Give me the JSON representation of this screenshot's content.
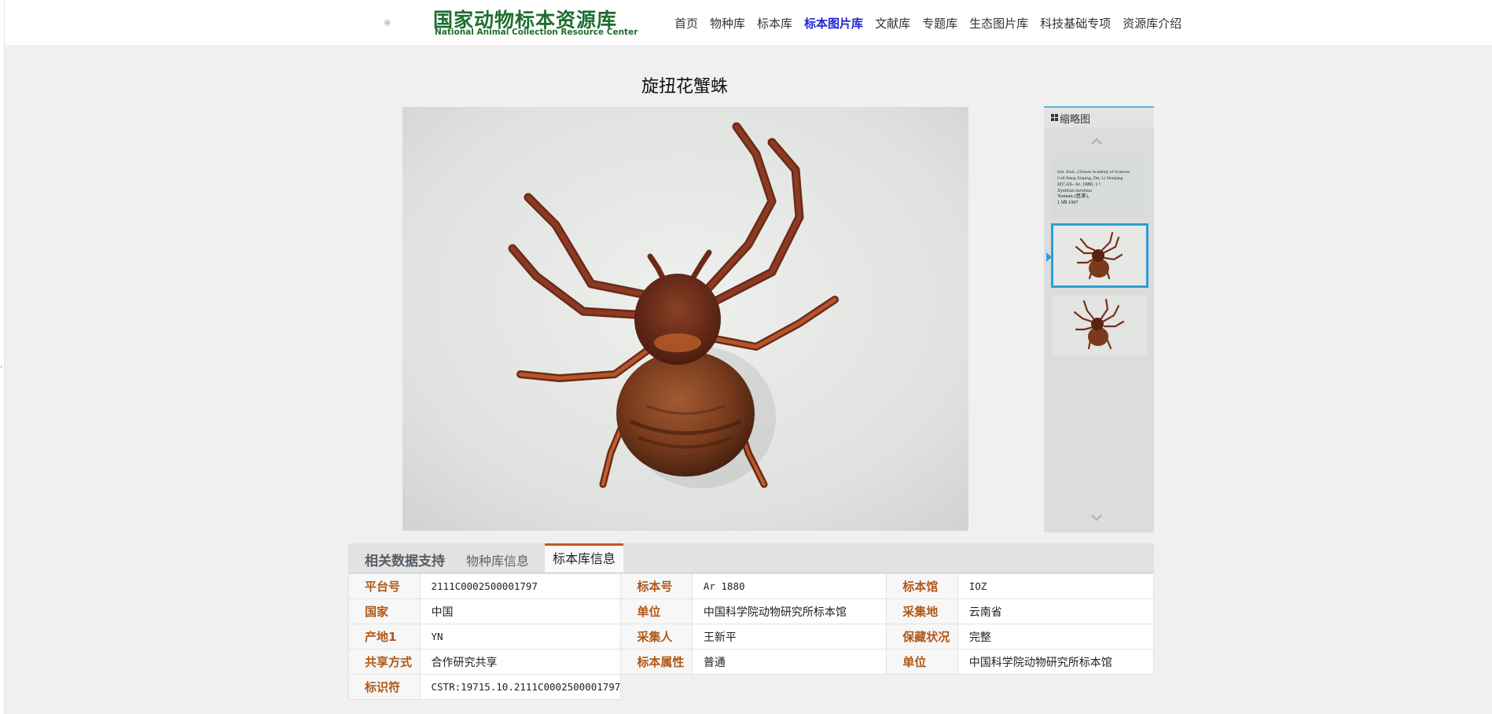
{
  "header": {
    "logo_title": "国家动物标本资源库",
    "logo_subtitle": "National Animal Collection Resource Center",
    "brand_color": "#1e6e30",
    "nav": [
      {
        "label": "首页",
        "active": false
      },
      {
        "label": "物种库",
        "active": false
      },
      {
        "label": "标本库",
        "active": false
      },
      {
        "label": "标本图片库",
        "active": true
      },
      {
        "label": "文献库",
        "active": false
      },
      {
        "label": "专题库",
        "active": false
      },
      {
        "label": "生态图片库",
        "active": false
      },
      {
        "label": "科技基础专项",
        "active": false
      },
      {
        "label": "资源库介绍",
        "active": false
      }
    ]
  },
  "page_title": "旋扭花蟹蛛",
  "thumbnails": {
    "heading": "缩略图",
    "icon": "grid-icon",
    "accent_color": "#2a9fd6",
    "label_card_lines": [
      "Inst. Zool., Chinese Academy of Sciences",
      "Coll.Wang Xinping, Det. Li Shuqiang",
      "IZCAS- Ar. 1880, 1♀",
      "Xysticus torsivus",
      "Yunnan (思茅),",
      "1.Ⅶ.1987"
    ],
    "items": [
      {
        "kind": "specimen-label",
        "selected": false
      },
      {
        "kind": "spider-photo",
        "selected": true
      },
      {
        "kind": "spider-photo-alt",
        "selected": false
      }
    ]
  },
  "tabs": {
    "title": "相关数据支持",
    "items": [
      {
        "label": "物种库信息",
        "active": false
      },
      {
        "label": "标本库信息",
        "active": true
      }
    ],
    "active_color": "#c05a1c"
  },
  "info": {
    "rows": [
      [
        {
          "k": "平台号",
          "v": "2111C0002500001797"
        },
        {
          "k": "标本号",
          "v": "Ar 1880"
        },
        {
          "k": "标本馆",
          "v": "IOZ"
        }
      ],
      [
        {
          "k": "国家",
          "v": "中国"
        },
        {
          "k": "单位",
          "v": "中国科学院动物研究所标本馆"
        },
        {
          "k": "采集地",
          "v": "云南省"
        }
      ],
      [
        {
          "k": "产地1",
          "v": "YN"
        },
        {
          "k": "采集人",
          "v": "王新平"
        },
        {
          "k": "保藏状况",
          "v": "完整"
        }
      ],
      [
        {
          "k": "共享方式",
          "v": "合作研究共享"
        },
        {
          "k": "标本属性",
          "v": "普通"
        },
        {
          "k": "单位",
          "v": "中国科学院动物研究所标本馆"
        }
      ],
      [
        {
          "k": "标识符",
          "v": "CSTR:19715.10.2111C0002500001797"
        }
      ]
    ],
    "key_color": "#b05818"
  }
}
